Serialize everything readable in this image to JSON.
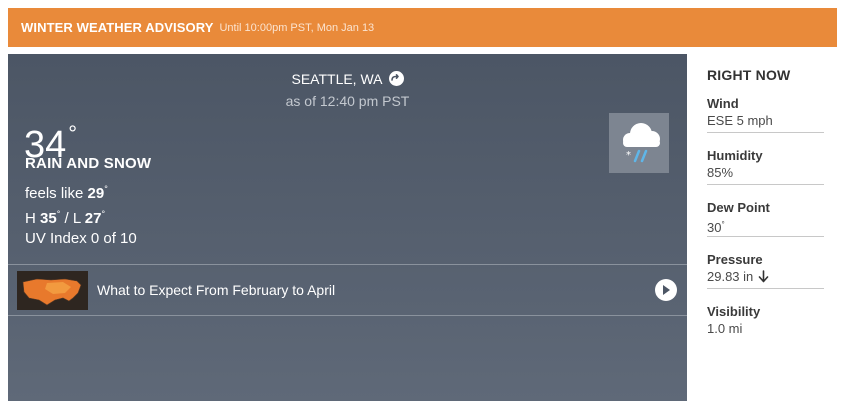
{
  "advisory": {
    "title": "WINTER WEATHER ADVISORY",
    "until": "Until 10:00pm PST, Mon Jan 13",
    "color": "#e98a3a"
  },
  "current": {
    "location": "SEATTLE, WA",
    "as_of": "as of 12:40 pm PST",
    "temperature": "34",
    "condition": "RAIN AND SNOW",
    "feels_like_label": "feels like",
    "feels_like": "29",
    "high_label": "H",
    "high": "35",
    "low_label": "L",
    "low": "27",
    "uv": "UV Index 0 of 10",
    "icon": "rain-snow-icon"
  },
  "promo": {
    "title": "What to Expect From February to April",
    "thumbnail_icon": "us-map-icon"
  },
  "right_now": {
    "title": "RIGHT NOW",
    "stats": [
      {
        "label": "Wind",
        "value": "ESE 5 mph"
      },
      {
        "label": "Humidity",
        "value": "85%"
      },
      {
        "label": "Dew Point",
        "value": "30"
      },
      {
        "label": "Pressure",
        "value": "29.83 in"
      },
      {
        "label": "Visibility",
        "value": "1.0 mi"
      }
    ]
  }
}
